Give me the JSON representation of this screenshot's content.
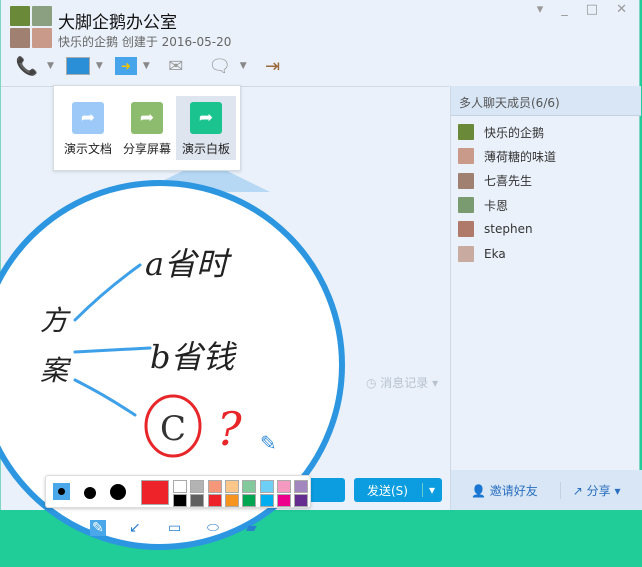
{
  "window": {
    "title": "大脚企鹅办公室",
    "subtitle": "快乐的企鹅 创建于 2016-05-20",
    "controls": [
      "▾",
      "_",
      "□",
      "✕"
    ]
  },
  "toolbar": {
    "icons": [
      "phone-icon",
      "presentation-icon",
      "file-transfer-icon",
      "mail-icon",
      "new-chat-icon",
      "exit-icon"
    ]
  },
  "popup": {
    "items": [
      {
        "label": "演示文档",
        "color": "#9cc9f8"
      },
      {
        "label": "分享屏幕",
        "color": "#8dbc6e"
      },
      {
        "label": "演示白板",
        "color": "#1bc48f"
      }
    ]
  },
  "members": {
    "header": "多人聊天成员(6/6)",
    "items": [
      {
        "name": "快乐的企鹅",
        "color": "#6a8a3a"
      },
      {
        "name": "薄荷糖的味道",
        "color": "#c99a8a"
      },
      {
        "name": "七喜先生",
        "color": "#a08070"
      },
      {
        "name": "卡恩",
        "color": "#7a9a70"
      },
      {
        "name": "stephen",
        "color": "#b07a6a"
      },
      {
        "name": "Eka",
        "color": "#c8aaa0"
      }
    ],
    "invite": "邀请好友",
    "share": "分享"
  },
  "chat": {
    "history": "消息记录",
    "send": "发送(S)"
  },
  "whiteboard": {
    "left1": "方",
    "left2": "案",
    "a": "a省时",
    "b": "b省钱",
    "c": "C",
    "q": "?"
  },
  "palette": {
    "current": "#ee2229",
    "row1": [
      "#ffffff",
      "#b3b3b3",
      "#f7977a",
      "#fdc68a",
      "#82ca9c",
      "#6dcff6",
      "#f49ac1",
      "#a187be"
    ],
    "row2": [
      "#000000",
      "#5f5f5f",
      "#ee2229",
      "#f7941d",
      "#00a651",
      "#00aeef",
      "#ec008c",
      "#662d91"
    ]
  },
  "tools": [
    "pencil-icon",
    "arrow-icon",
    "rectangle-icon",
    "ellipse-icon",
    "eraser-icon"
  ]
}
